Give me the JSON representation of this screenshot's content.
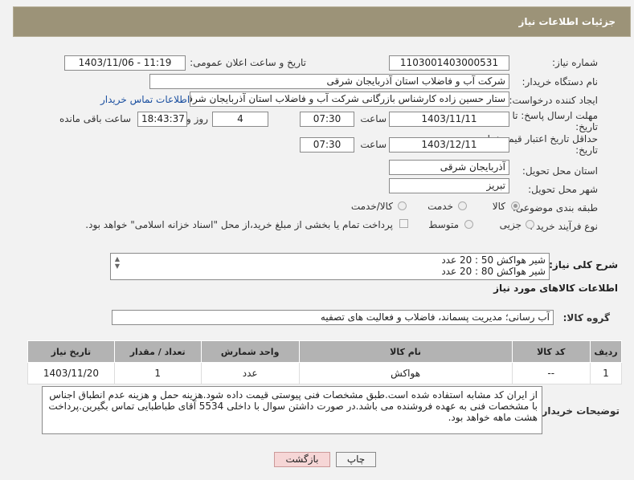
{
  "header": {
    "title": "جزئیات اطلاعات نیاز"
  },
  "fields": {
    "need_number_label": "شماره نیاز:",
    "need_number": "1103001403000531",
    "announce_label": "تاریخ و ساعت اعلان عمومی:",
    "announce_value": "1403/11/06 - 11:19",
    "buyer_label": "نام دستگاه خریدار:",
    "buyer": "شرکت آب و فاضلاب استان آذربایجان شرقی",
    "creator_label": "ایجاد کننده درخواست:",
    "creator": "ستار حسین زاده کارشناس بازرگانی شرکت آب و فاضلاب استان آذربایجان شرقی",
    "contact_link": "اطلاعات تماس خریدار",
    "deadline_label_1": "مهلت ارسال پاسخ: تا",
    "deadline_label_2": "تاریخ:",
    "deadline_date": "1403/11/11",
    "time_label": "ساعت",
    "deadline_time": "07:30",
    "days_value": "4",
    "days_label": "روز و",
    "remaining_value": "18:43:37",
    "remaining_label": "ساعت باقی مانده",
    "validity_label_1": "حداقل تاریخ اعتبار قیمت: تا",
    "validity_label_2": "تاریخ:",
    "validity_date": "1403/12/11",
    "validity_time": "07:30",
    "province_label": "استان محل تحویل:",
    "province": "آذربایجان شرقی",
    "city_label": "شهر محل تحویل:",
    "city": "تبریز",
    "category_label": "طبقه بندی موضوعی:",
    "category_options": [
      "کالا",
      "خدمت",
      "کالا/خدمت"
    ],
    "process_label": "نوع فرآیند خرید :",
    "process_options": [
      "جزیی",
      "متوسط"
    ],
    "payment_text": "پرداخت تمام یا بخشی از مبلغ خرید،از محل \"اسناد خزانه اسلامی\" خواهد بود."
  },
  "description": {
    "label": "شرح کلی نیاز:",
    "line1": "شیر هواکش 50 : 20 عدد",
    "line2": "شیر هواکش 80 : 20 عدد"
  },
  "goods": {
    "section_title": "اطلاعات کالاهای مورد نیاز",
    "group_label": "گروه کالا:",
    "group_value": "آب رسانی؛ مدیریت پسماند، فاضلاب و فعالیت های تصفیه",
    "columns": [
      "ردیف",
      "کد کالا",
      "نام کالا",
      "واحد شمارش",
      "تعداد / مقدار",
      "تاریخ نیاز"
    ],
    "rows": [
      {
        "row": "1",
        "code": "--",
        "name": "هواکش",
        "unit": "عدد",
        "qty": "1",
        "date": "1403/11/20"
      }
    ]
  },
  "buyer_notes": {
    "label": "توضیحات خریدار:",
    "text": "از ایران کد مشابه استفاده شده است.طبق مشخصات فنی پیوستی قیمت داده شود.هزینه حمل و هزینه عدم انطباق اجناس با مشخصات فنی به عهده فروشنده می باشد.در صورت داشتن سوال با داخلی 5534 آقای طباطبایی تماس بگیرین.پرداخت هشت ماهه خواهد بود."
  },
  "buttons": {
    "print": "چاپ",
    "back": "بازگشت"
  },
  "colors": {
    "header_bg": "#9c9378",
    "table_header_bg": "#b3b3b3",
    "link": "#1a4fa0",
    "back_btn": "#f6d6d6"
  }
}
